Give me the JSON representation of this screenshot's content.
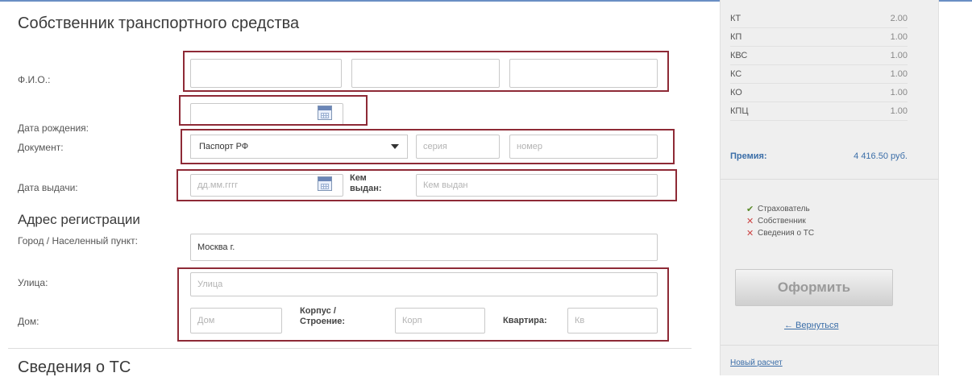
{
  "owner_section": {
    "title": "Собственник транспортного средства",
    "fio_label": "Ф.И.О.:",
    "birth_label": "Дата рождения:",
    "document_label": "Документ:",
    "document_type": "Паспорт РФ",
    "series_placeholder": "серия",
    "number_placeholder": "номер",
    "issue_date_label": "Дата выдачи:",
    "issue_date_placeholder": "дд.мм.гггг",
    "issued_by_label": "Кем выдан:",
    "issued_by_placeholder": "Кем выдан"
  },
  "address_section": {
    "title": "Адрес регистрации",
    "city_label": "Город / Населенный пункт:",
    "city_value": "Москва г.",
    "street_label": "Улица:",
    "street_placeholder": "Улица",
    "house_label": "Дом:",
    "house_placeholder": "Дом",
    "building_label": "Корпус / Строение:",
    "building_placeholder": "Корп",
    "apartment_label": "Квартира:",
    "apartment_placeholder": "Кв"
  },
  "vehicle_section": {
    "title": "Сведения о ТС"
  },
  "summary": {
    "coefficients": [
      {
        "name": "КТ",
        "value": "2.00"
      },
      {
        "name": "КП",
        "value": "1.00"
      },
      {
        "name": "КВС",
        "value": "1.00"
      },
      {
        "name": "КС",
        "value": "1.00"
      },
      {
        "name": "КО",
        "value": "1.00"
      },
      {
        "name": "КПЦ",
        "value": "1.00"
      }
    ],
    "premium_label": "Премия:",
    "premium_value": "4 416.50 руб.",
    "steps": [
      {
        "mark": "✔",
        "label": "Страхователь",
        "color": "#5a8a2a"
      },
      {
        "mark": "✕",
        "label": "Собственник",
        "color": "#cc4444"
      },
      {
        "mark": "✕",
        "label": "Сведения о ТС",
        "color": "#cc4444"
      }
    ],
    "submit_label": "Оформить",
    "back_link": "← Вернуться",
    "new_calc_link": "Новый расчет"
  },
  "colors": {
    "highlight_box": "#8e2a36",
    "link": "#3b6ea8"
  }
}
